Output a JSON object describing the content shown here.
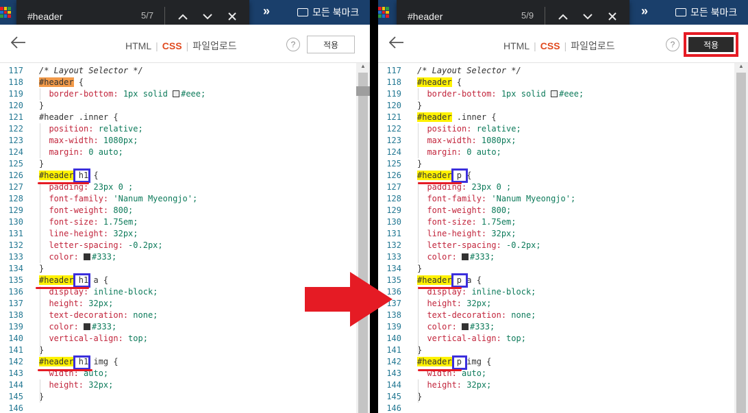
{
  "left": {
    "find": {
      "query": "#header",
      "count": "5/7"
    },
    "bookmark_label": "모든 북마크",
    "tabs": [
      "HTML",
      "CSS",
      "파일업로드"
    ],
    "help": "?",
    "apply": "적용",
    "lines": [
      {
        "n": "117",
        "p": [
          {
            "t": "/* Layout Selector */",
            "c": "cmt"
          }
        ]
      },
      {
        "n": "118",
        "p": [
          {
            "t": "#header",
            "c": "hl-orange"
          },
          {
            "t": " {",
            "c": ""
          }
        ]
      },
      {
        "n": "119",
        "p": [
          {
            "t": "  ",
            "c": ""
          },
          {
            "t": "border-bottom:",
            "c": "prop"
          },
          {
            "t": " 1px solid ",
            "c": "val"
          },
          {
            "sw": "#eeeeee"
          },
          {
            "t": "#eee;",
            "c": "val"
          }
        ]
      },
      {
        "n": "120",
        "p": [
          {
            "t": "}",
            "c": ""
          }
        ]
      },
      {
        "n": "121",
        "p": [
          {
            "t": "#header .inner {",
            "c": ""
          }
        ]
      },
      {
        "n": "122",
        "p": [
          {
            "t": "  ",
            "c": ""
          },
          {
            "t": "position:",
            "c": "prop"
          },
          {
            "t": " relative;",
            "c": "val"
          }
        ]
      },
      {
        "n": "123",
        "p": [
          {
            "t": "  ",
            "c": ""
          },
          {
            "t": "max-width:",
            "c": "prop"
          },
          {
            "t": " 1080px;",
            "c": "val"
          }
        ]
      },
      {
        "n": "124",
        "p": [
          {
            "t": "  ",
            "c": ""
          },
          {
            "t": "margin:",
            "c": "prop"
          },
          {
            "t": " 0 auto;",
            "c": "val"
          }
        ]
      },
      {
        "n": "125",
        "p": [
          {
            "t": "}",
            "c": ""
          }
        ]
      },
      {
        "n": "126",
        "p": [
          {
            "t": "#header",
            "c": "hl-yellow"
          },
          {
            "t": " h1 {",
            "c": ""
          }
        ]
      },
      {
        "n": "127",
        "p": [
          {
            "t": "  ",
            "c": ""
          },
          {
            "t": "padding:",
            "c": "prop"
          },
          {
            "t": " 23px 0 ;",
            "c": "val"
          }
        ]
      },
      {
        "n": "128",
        "p": [
          {
            "t": "  ",
            "c": ""
          },
          {
            "t": "font-family:",
            "c": "prop"
          },
          {
            "t": " 'Nanum Myeongjo';",
            "c": "val"
          }
        ]
      },
      {
        "n": "129",
        "p": [
          {
            "t": "  ",
            "c": ""
          },
          {
            "t": "font-weight:",
            "c": "prop"
          },
          {
            "t": " 800;",
            "c": "val"
          }
        ]
      },
      {
        "n": "130",
        "p": [
          {
            "t": "  ",
            "c": ""
          },
          {
            "t": "font-size:",
            "c": "prop"
          },
          {
            "t": " 1.75em;",
            "c": "val"
          }
        ]
      },
      {
        "n": "131",
        "p": [
          {
            "t": "  ",
            "c": ""
          },
          {
            "t": "line-height:",
            "c": "prop"
          },
          {
            "t": " 32px;",
            "c": "val"
          }
        ]
      },
      {
        "n": "132",
        "p": [
          {
            "t": "  ",
            "c": ""
          },
          {
            "t": "letter-spacing:",
            "c": "prop"
          },
          {
            "t": " -0.2px;",
            "c": "val"
          }
        ]
      },
      {
        "n": "133",
        "p": [
          {
            "t": "  ",
            "c": ""
          },
          {
            "t": "color:",
            "c": "prop"
          },
          {
            "t": " ",
            "c": ""
          },
          {
            "sw": "#333333"
          },
          {
            "t": "#333;",
            "c": "val"
          }
        ]
      },
      {
        "n": "134",
        "p": [
          {
            "t": "}",
            "c": ""
          }
        ]
      },
      {
        "n": "135",
        "p": [
          {
            "t": "#header",
            "c": "hl-yellow"
          },
          {
            "t": " h1 a {",
            "c": ""
          }
        ]
      },
      {
        "n": "136",
        "p": [
          {
            "t": "  ",
            "c": ""
          },
          {
            "t": "display:",
            "c": "prop"
          },
          {
            "t": " inline-block;",
            "c": "val"
          }
        ]
      },
      {
        "n": "137",
        "p": [
          {
            "t": "  ",
            "c": ""
          },
          {
            "t": "height:",
            "c": "prop"
          },
          {
            "t": " 32px;",
            "c": "val"
          }
        ]
      },
      {
        "n": "138",
        "p": [
          {
            "t": "  ",
            "c": ""
          },
          {
            "t": "text-decoration:",
            "c": "prop"
          },
          {
            "t": " none;",
            "c": "val"
          }
        ]
      },
      {
        "n": "139",
        "p": [
          {
            "t": "  ",
            "c": ""
          },
          {
            "t": "color:",
            "c": "prop"
          },
          {
            "t": " ",
            "c": ""
          },
          {
            "sw": "#333333"
          },
          {
            "t": "#333;",
            "c": "val"
          }
        ]
      },
      {
        "n": "140",
        "p": [
          {
            "t": "  ",
            "c": ""
          },
          {
            "t": "vertical-align:",
            "c": "prop"
          },
          {
            "t": " top;",
            "c": "val"
          }
        ]
      },
      {
        "n": "141",
        "p": [
          {
            "t": "}",
            "c": ""
          }
        ]
      },
      {
        "n": "142",
        "p": [
          {
            "t": "#header",
            "c": "hl-yellow"
          },
          {
            "t": " h1 img {",
            "c": ""
          }
        ]
      },
      {
        "n": "143",
        "p": [
          {
            "t": "  ",
            "c": ""
          },
          {
            "t": "width:",
            "c": "prop"
          },
          {
            "t": " auto;",
            "c": "val"
          }
        ]
      },
      {
        "n": "144",
        "p": [
          {
            "t": "  ",
            "c": ""
          },
          {
            "t": "height:",
            "c": "prop"
          },
          {
            "t": " 32px;",
            "c": "val"
          }
        ]
      },
      {
        "n": "145",
        "p": [
          {
            "t": "}",
            "c": ""
          }
        ]
      },
      {
        "n": "146",
        "p": []
      }
    ]
  },
  "right": {
    "find": {
      "query": "#header",
      "count": "5/9"
    },
    "bookmark_label": "모든 북마크",
    "tabs": [
      "HTML",
      "CSS",
      "파일업로드"
    ],
    "help": "?",
    "apply": "적용",
    "lines": [
      {
        "n": "117",
        "p": [
          {
            "t": "/* Layout Selector */",
            "c": "cmt"
          }
        ]
      },
      {
        "n": "118",
        "p": [
          {
            "t": "#header",
            "c": "hl-yellow"
          },
          {
            "t": " {",
            "c": ""
          }
        ]
      },
      {
        "n": "119",
        "p": [
          {
            "t": "  ",
            "c": ""
          },
          {
            "t": "border-bottom:",
            "c": "prop"
          },
          {
            "t": " 1px solid ",
            "c": "val"
          },
          {
            "sw": "#eeeeee"
          },
          {
            "t": "#eee;",
            "c": "val"
          }
        ]
      },
      {
        "n": "120",
        "p": [
          {
            "t": "}",
            "c": ""
          }
        ]
      },
      {
        "n": "121",
        "p": [
          {
            "t": "#header",
            "c": "hl-yellow"
          },
          {
            "t": " .inner {",
            "c": ""
          }
        ]
      },
      {
        "n": "122",
        "p": [
          {
            "t": "  ",
            "c": ""
          },
          {
            "t": "position:",
            "c": "prop"
          },
          {
            "t": " relative;",
            "c": "val"
          }
        ]
      },
      {
        "n": "123",
        "p": [
          {
            "t": "  ",
            "c": ""
          },
          {
            "t": "max-width:",
            "c": "prop"
          },
          {
            "t": " 1080px;",
            "c": "val"
          }
        ]
      },
      {
        "n": "124",
        "p": [
          {
            "t": "  ",
            "c": ""
          },
          {
            "t": "margin:",
            "c": "prop"
          },
          {
            "t": " 0 auto;",
            "c": "val"
          }
        ]
      },
      {
        "n": "125",
        "p": [
          {
            "t": "}",
            "c": ""
          }
        ]
      },
      {
        "n": "126",
        "p": [
          {
            "t": "#header",
            "c": "hl-yellow"
          },
          {
            "t": " p {",
            "c": ""
          }
        ]
      },
      {
        "n": "127",
        "p": [
          {
            "t": "  ",
            "c": ""
          },
          {
            "t": "padding:",
            "c": "prop"
          },
          {
            "t": " 23px 0 ;",
            "c": "val"
          }
        ]
      },
      {
        "n": "128",
        "p": [
          {
            "t": "  ",
            "c": ""
          },
          {
            "t": "font-family:",
            "c": "prop"
          },
          {
            "t": " 'Nanum Myeongjo';",
            "c": "val"
          }
        ]
      },
      {
        "n": "129",
        "p": [
          {
            "t": "  ",
            "c": ""
          },
          {
            "t": "font-weight:",
            "c": "prop"
          },
          {
            "t": " 800;",
            "c": "val"
          }
        ]
      },
      {
        "n": "130",
        "p": [
          {
            "t": "  ",
            "c": ""
          },
          {
            "t": "font-size:",
            "c": "prop"
          },
          {
            "t": " 1.75em;",
            "c": "val"
          }
        ]
      },
      {
        "n": "131",
        "p": [
          {
            "t": "  ",
            "c": ""
          },
          {
            "t": "line-height:",
            "c": "prop"
          },
          {
            "t": " 32px;",
            "c": "val"
          }
        ]
      },
      {
        "n": "132",
        "p": [
          {
            "t": "  ",
            "c": ""
          },
          {
            "t": "letter-spacing:",
            "c": "prop"
          },
          {
            "t": " -0.2px;",
            "c": "val"
          }
        ]
      },
      {
        "n": "133",
        "p": [
          {
            "t": "  ",
            "c": ""
          },
          {
            "t": "color:",
            "c": "prop"
          },
          {
            "t": " ",
            "c": ""
          },
          {
            "sw": "#333333"
          },
          {
            "t": "#333;",
            "c": "val"
          }
        ]
      },
      {
        "n": "134",
        "p": [
          {
            "t": "}",
            "c": ""
          }
        ]
      },
      {
        "n": "135",
        "p": [
          {
            "t": "#header",
            "c": "hl-yellow"
          },
          {
            "t": " p a {",
            "c": ""
          }
        ]
      },
      {
        "n": "136",
        "p": [
          {
            "t": "  ",
            "c": ""
          },
          {
            "t": "display:",
            "c": "prop"
          },
          {
            "t": " inline-block;",
            "c": "val"
          }
        ]
      },
      {
        "n": "137",
        "p": [
          {
            "t": "  ",
            "c": ""
          },
          {
            "t": "height:",
            "c": "prop"
          },
          {
            "t": " 32px;",
            "c": "val"
          }
        ]
      },
      {
        "n": "138",
        "p": [
          {
            "t": "  ",
            "c": ""
          },
          {
            "t": "text-decoration:",
            "c": "prop"
          },
          {
            "t": " none;",
            "c": "val"
          }
        ]
      },
      {
        "n": "139",
        "p": [
          {
            "t": "  ",
            "c": ""
          },
          {
            "t": "color:",
            "c": "prop"
          },
          {
            "t": " ",
            "c": ""
          },
          {
            "sw": "#333333"
          },
          {
            "t": "#333;",
            "c": "val"
          }
        ]
      },
      {
        "n": "140",
        "p": [
          {
            "t": "  ",
            "c": ""
          },
          {
            "t": "vertical-align:",
            "c": "prop"
          },
          {
            "t": " top;",
            "c": "val"
          }
        ]
      },
      {
        "n": "141",
        "p": [
          {
            "t": "}",
            "c": ""
          }
        ]
      },
      {
        "n": "142",
        "p": [
          {
            "t": "#header",
            "c": "hl-yellow"
          },
          {
            "t": " p img {",
            "c": ""
          }
        ]
      },
      {
        "n": "143",
        "p": [
          {
            "t": "  ",
            "c": ""
          },
          {
            "t": "width:",
            "c": "prop"
          },
          {
            "t": " auto;",
            "c": "val"
          }
        ]
      },
      {
        "n": "144",
        "p": [
          {
            "t": "  ",
            "c": ""
          },
          {
            "t": "height:",
            "c": "prop"
          },
          {
            "t": " 32px;",
            "c": "val"
          }
        ]
      },
      {
        "n": "145",
        "p": [
          {
            "t": "}",
            "c": ""
          }
        ]
      },
      {
        "n": "146",
        "p": []
      }
    ]
  },
  "colors": {
    "topbar": "#1a3f6b",
    "css_tab_active": "#e04a1f",
    "highlight_match": "#fff200",
    "highlight_current": "#f39b4a",
    "annotation_box": "#3b2fdc",
    "annotation_underline": "#e51b24",
    "arrow": "#e51b24"
  }
}
